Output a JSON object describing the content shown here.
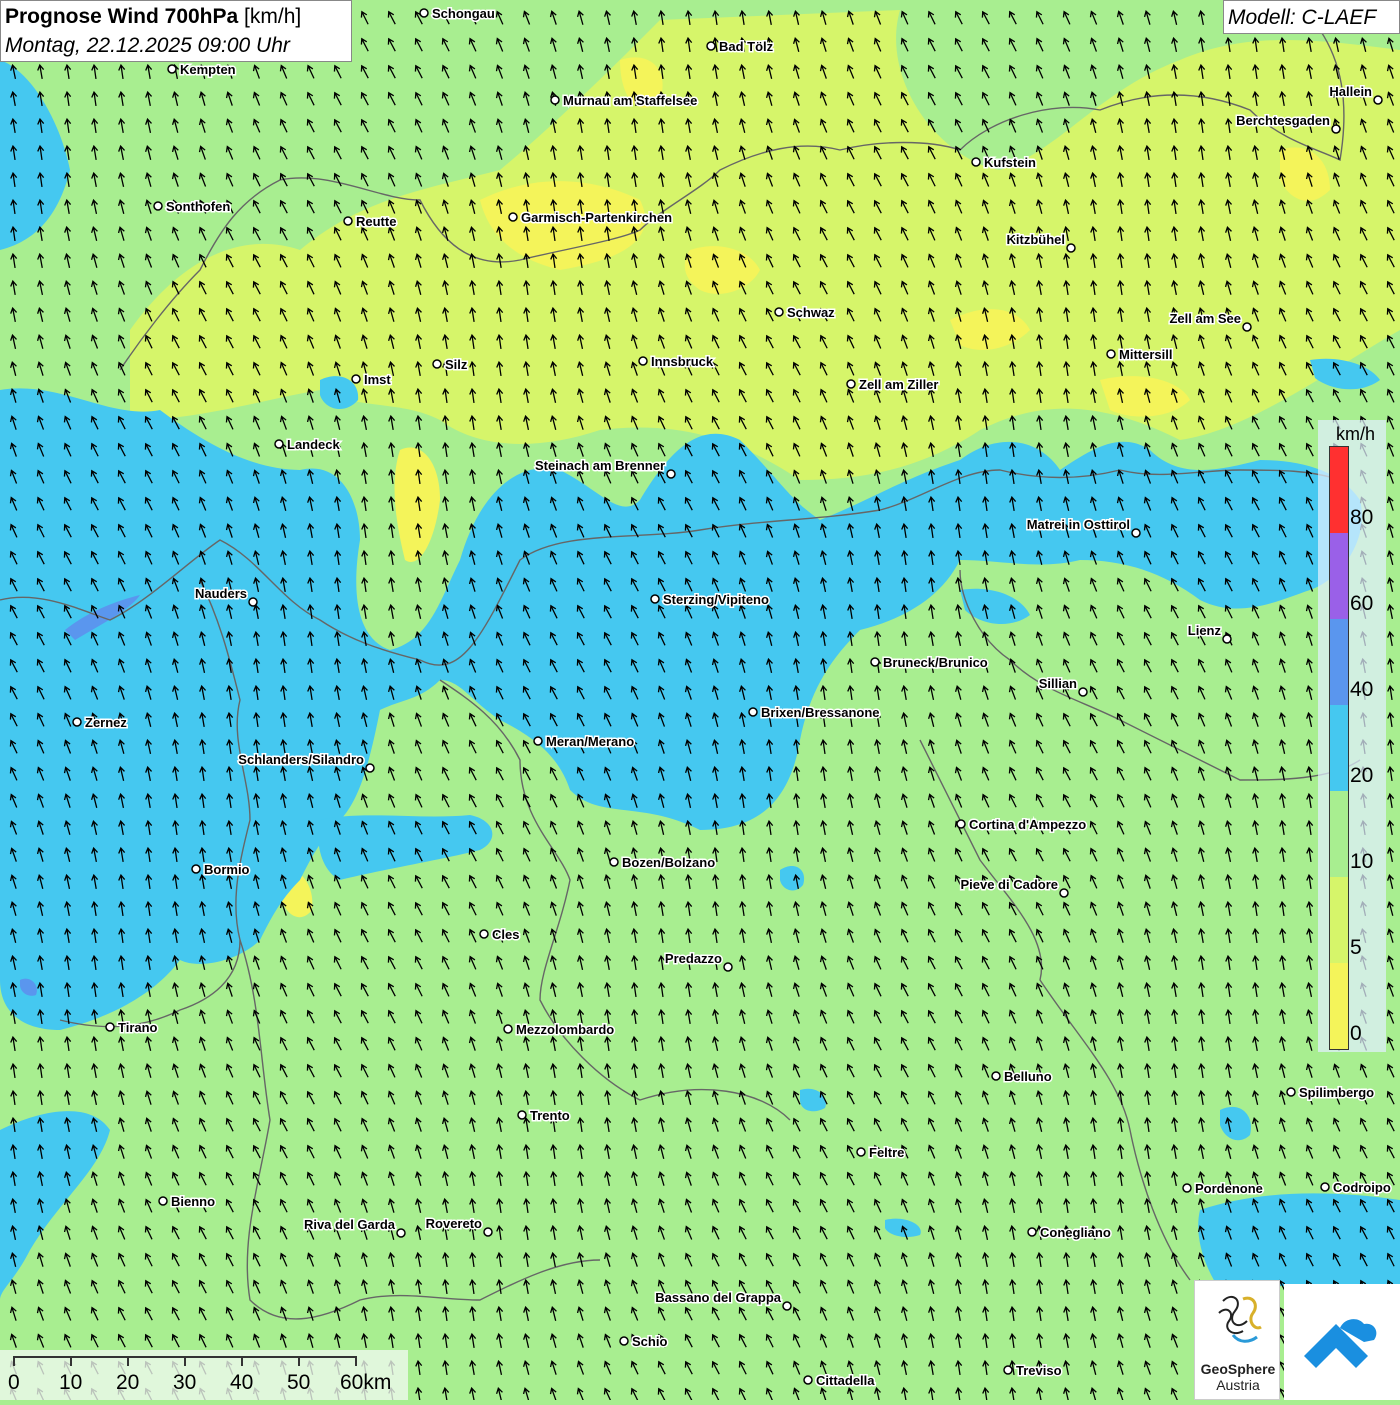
{
  "title": {
    "main": "Prognose Wind 700hPa",
    "unit": "[km/h]",
    "datetime": "Montag, 22.12.2025 09:00 Uhr"
  },
  "model": "Modell: C-LAEF",
  "legend": {
    "unit": "km/h",
    "ticks": [
      "0",
      "5",
      "10",
      "20",
      "40",
      "60",
      "80"
    ],
    "colors": [
      "#f4f45a",
      "#d6f56a",
      "#a8ee90",
      "#45c8f0",
      "#5a96ee",
      "#9a60e8",
      "#ff3030"
    ]
  },
  "scale_bar": {
    "labels": [
      "0",
      "10",
      "20",
      "30",
      "40",
      "50",
      "60km"
    ]
  },
  "cities": [
    {
      "name": "Schongau"
    },
    {
      "name": "Bad Tölz"
    },
    {
      "name": "Kempten"
    },
    {
      "name": "Murnau am Staffelsee"
    },
    {
      "name": "Hallein"
    },
    {
      "name": "Berchtesgaden"
    },
    {
      "name": "Kufstein"
    },
    {
      "name": "Sonthofen"
    },
    {
      "name": "Reutte"
    },
    {
      "name": "Garmisch-Partenkirchen"
    },
    {
      "name": "Kitzbühel"
    },
    {
      "name": "Schwaz"
    },
    {
      "name": "Zell am See"
    },
    {
      "name": "Mittersill"
    },
    {
      "name": "Imst"
    },
    {
      "name": "Silz"
    },
    {
      "name": "Innsbruck"
    },
    {
      "name": "Zell am Ziller"
    },
    {
      "name": "Landeck"
    },
    {
      "name": "Steinach am Brenner"
    },
    {
      "name": "Matrei in Osttirol"
    },
    {
      "name": "Nauders"
    },
    {
      "name": "Sterzing/Vipiteno"
    },
    {
      "name": "Lienz"
    },
    {
      "name": "Bruneck/Brunico"
    },
    {
      "name": "Sillian"
    },
    {
      "name": "Zernez"
    },
    {
      "name": "Brixen/Bressanone"
    },
    {
      "name": "Meran/Merano"
    },
    {
      "name": "Schlanders/Silandro"
    },
    {
      "name": "Cortina d'Ampezzo"
    },
    {
      "name": "Bormio"
    },
    {
      "name": "Bozen/Bolzano"
    },
    {
      "name": "Pieve di Cadore"
    },
    {
      "name": "Cles"
    },
    {
      "name": "Predazzo"
    },
    {
      "name": "Tirano"
    },
    {
      "name": "Mezzolombardo"
    },
    {
      "name": "Belluno"
    },
    {
      "name": "Spilimbergo"
    },
    {
      "name": "Trento"
    },
    {
      "name": "Feltre"
    },
    {
      "name": "Pordenone"
    },
    {
      "name": "Codroipo"
    },
    {
      "name": "Bienno"
    },
    {
      "name": "Riva del Garda"
    },
    {
      "name": "Rovereto"
    },
    {
      "name": "Conegliano"
    },
    {
      "name": "Bassano del Grappa"
    },
    {
      "name": "Schio"
    },
    {
      "name": "Treviso"
    },
    {
      "name": "Cittadella"
    }
  ],
  "logos": {
    "geosphere_name": "GeoSphere",
    "geosphere_sub": "Austria"
  },
  "colors": {
    "wind_0_5": "#f4f45a",
    "wind_5_10": "#d6f56a",
    "wind_10_20": "#a8ee90",
    "wind_20_40": "#45c8f0",
    "wind_40_60": "#5a96ee",
    "wind_60_80": "#9a60e8",
    "wind_80_plus": "#ff3030",
    "background_green": "#a8ee90",
    "arrow": "#000000",
    "border_line": "#666666",
    "geosphere_blue": "#1a8fe0"
  }
}
